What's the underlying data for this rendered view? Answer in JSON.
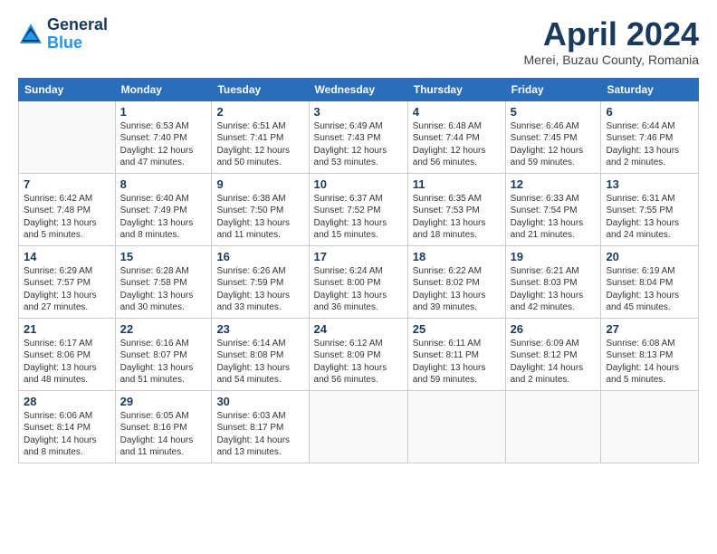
{
  "header": {
    "logo_general": "General",
    "logo_blue": "Blue",
    "title": "April 2024",
    "subtitle": "Merei, Buzau County, Romania"
  },
  "weekdays": [
    "Sunday",
    "Monday",
    "Tuesday",
    "Wednesday",
    "Thursday",
    "Friday",
    "Saturday"
  ],
  "weeks": [
    [
      {
        "day": "",
        "info": ""
      },
      {
        "day": "1",
        "info": "Sunrise: 6:53 AM\nSunset: 7:40 PM\nDaylight: 12 hours\nand 47 minutes."
      },
      {
        "day": "2",
        "info": "Sunrise: 6:51 AM\nSunset: 7:41 PM\nDaylight: 12 hours\nand 50 minutes."
      },
      {
        "day": "3",
        "info": "Sunrise: 6:49 AM\nSunset: 7:43 PM\nDaylight: 12 hours\nand 53 minutes."
      },
      {
        "day": "4",
        "info": "Sunrise: 6:48 AM\nSunset: 7:44 PM\nDaylight: 12 hours\nand 56 minutes."
      },
      {
        "day": "5",
        "info": "Sunrise: 6:46 AM\nSunset: 7:45 PM\nDaylight: 12 hours\nand 59 minutes."
      },
      {
        "day": "6",
        "info": "Sunrise: 6:44 AM\nSunset: 7:46 PM\nDaylight: 13 hours\nand 2 minutes."
      }
    ],
    [
      {
        "day": "7",
        "info": "Sunrise: 6:42 AM\nSunset: 7:48 PM\nDaylight: 13 hours\nand 5 minutes."
      },
      {
        "day": "8",
        "info": "Sunrise: 6:40 AM\nSunset: 7:49 PM\nDaylight: 13 hours\nand 8 minutes."
      },
      {
        "day": "9",
        "info": "Sunrise: 6:38 AM\nSunset: 7:50 PM\nDaylight: 13 hours\nand 11 minutes."
      },
      {
        "day": "10",
        "info": "Sunrise: 6:37 AM\nSunset: 7:52 PM\nDaylight: 13 hours\nand 15 minutes."
      },
      {
        "day": "11",
        "info": "Sunrise: 6:35 AM\nSunset: 7:53 PM\nDaylight: 13 hours\nand 18 minutes."
      },
      {
        "day": "12",
        "info": "Sunrise: 6:33 AM\nSunset: 7:54 PM\nDaylight: 13 hours\nand 21 minutes."
      },
      {
        "day": "13",
        "info": "Sunrise: 6:31 AM\nSunset: 7:55 PM\nDaylight: 13 hours\nand 24 minutes."
      }
    ],
    [
      {
        "day": "14",
        "info": "Sunrise: 6:29 AM\nSunset: 7:57 PM\nDaylight: 13 hours\nand 27 minutes."
      },
      {
        "day": "15",
        "info": "Sunrise: 6:28 AM\nSunset: 7:58 PM\nDaylight: 13 hours\nand 30 minutes."
      },
      {
        "day": "16",
        "info": "Sunrise: 6:26 AM\nSunset: 7:59 PM\nDaylight: 13 hours\nand 33 minutes."
      },
      {
        "day": "17",
        "info": "Sunrise: 6:24 AM\nSunset: 8:00 PM\nDaylight: 13 hours\nand 36 minutes."
      },
      {
        "day": "18",
        "info": "Sunrise: 6:22 AM\nSunset: 8:02 PM\nDaylight: 13 hours\nand 39 minutes."
      },
      {
        "day": "19",
        "info": "Sunrise: 6:21 AM\nSunset: 8:03 PM\nDaylight: 13 hours\nand 42 minutes."
      },
      {
        "day": "20",
        "info": "Sunrise: 6:19 AM\nSunset: 8:04 PM\nDaylight: 13 hours\nand 45 minutes."
      }
    ],
    [
      {
        "day": "21",
        "info": "Sunrise: 6:17 AM\nSunset: 8:06 PM\nDaylight: 13 hours\nand 48 minutes."
      },
      {
        "day": "22",
        "info": "Sunrise: 6:16 AM\nSunset: 8:07 PM\nDaylight: 13 hours\nand 51 minutes."
      },
      {
        "day": "23",
        "info": "Sunrise: 6:14 AM\nSunset: 8:08 PM\nDaylight: 13 hours\nand 54 minutes."
      },
      {
        "day": "24",
        "info": "Sunrise: 6:12 AM\nSunset: 8:09 PM\nDaylight: 13 hours\nand 56 minutes."
      },
      {
        "day": "25",
        "info": "Sunrise: 6:11 AM\nSunset: 8:11 PM\nDaylight: 13 hours\nand 59 minutes."
      },
      {
        "day": "26",
        "info": "Sunrise: 6:09 AM\nSunset: 8:12 PM\nDaylight: 14 hours\nand 2 minutes."
      },
      {
        "day": "27",
        "info": "Sunrise: 6:08 AM\nSunset: 8:13 PM\nDaylight: 14 hours\nand 5 minutes."
      }
    ],
    [
      {
        "day": "28",
        "info": "Sunrise: 6:06 AM\nSunset: 8:14 PM\nDaylight: 14 hours\nand 8 minutes."
      },
      {
        "day": "29",
        "info": "Sunrise: 6:05 AM\nSunset: 8:16 PM\nDaylight: 14 hours\nand 11 minutes."
      },
      {
        "day": "30",
        "info": "Sunrise: 6:03 AM\nSunset: 8:17 PM\nDaylight: 14 hours\nand 13 minutes."
      },
      {
        "day": "",
        "info": ""
      },
      {
        "day": "",
        "info": ""
      },
      {
        "day": "",
        "info": ""
      },
      {
        "day": "",
        "info": ""
      }
    ]
  ]
}
